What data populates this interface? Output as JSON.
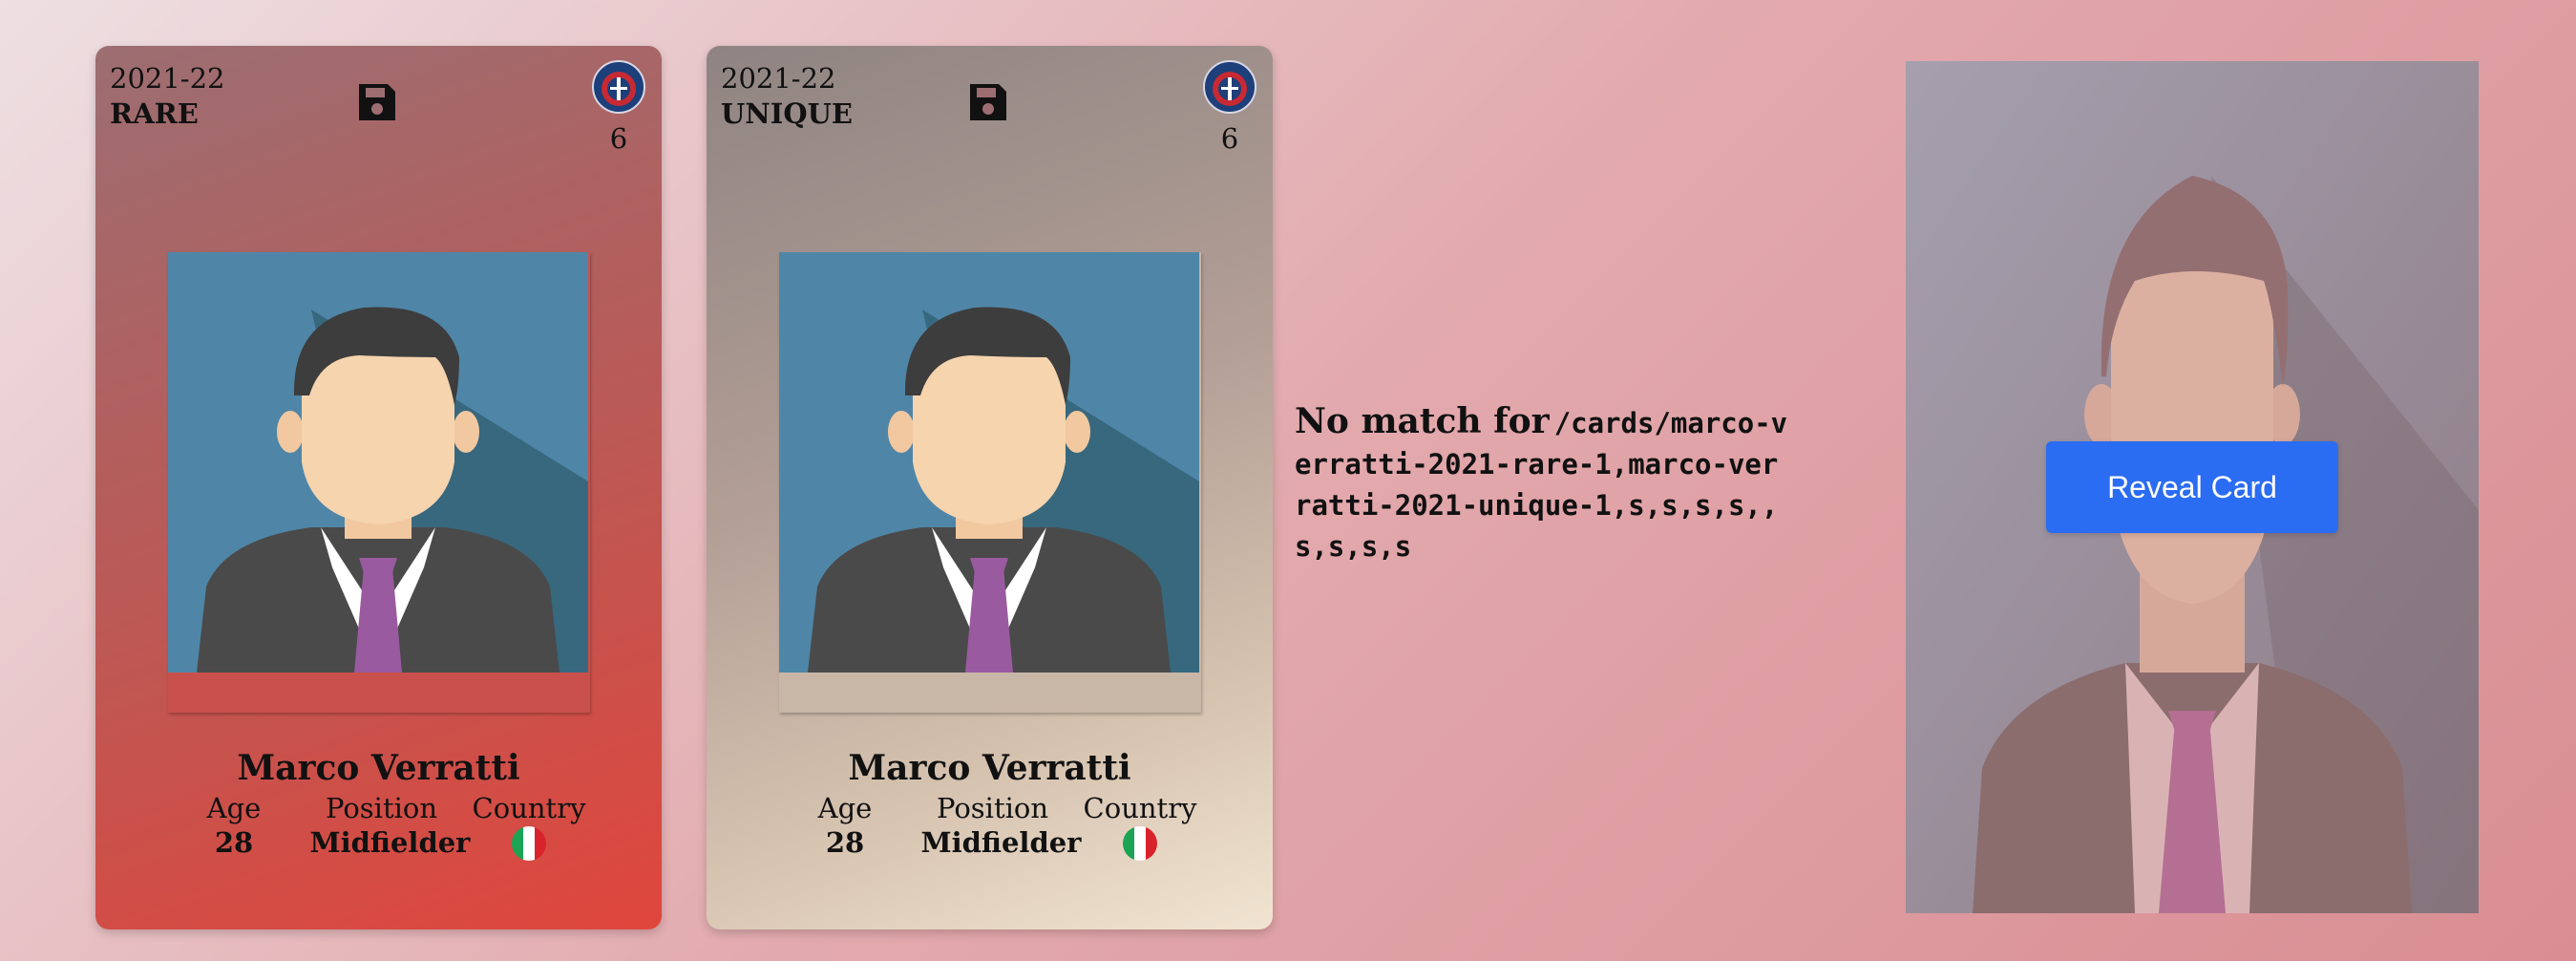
{
  "cards": [
    {
      "season": "2021-22",
      "rarity": "RARE",
      "number": "6",
      "club_icon": "psg-crest-icon",
      "save_icon": "floppy-disk-icon",
      "player": {
        "name": "Marco Verratti",
        "age_label": "Age",
        "age": "28",
        "position_label": "Position",
        "position": "Midfielder",
        "country_label": "Country",
        "country_flag": "italy-flag-icon"
      }
    },
    {
      "season": "2021-22",
      "rarity": "UNIQUE",
      "number": "6",
      "club_icon": "psg-crest-icon",
      "save_icon": "floppy-disk-icon",
      "player": {
        "name": "Marco Verratti",
        "age_label": "Age",
        "age": "28",
        "position_label": "Position",
        "position": "Midfielder",
        "country_label": "Country",
        "country_flag": "italy-flag-icon"
      }
    }
  ],
  "message": {
    "lead": "No match for",
    "path": "/cards/marco-verratti-2021-rare-1,marco-verratti-2021-unique-1,s,s,s,s,,s,s,s,s"
  },
  "mystery_card": {
    "button_label": "Reveal Card"
  },
  "colors": {
    "button": "#2a6cf2",
    "rare_card": "#d9483f",
    "unique_card": "#f2e4d2"
  }
}
